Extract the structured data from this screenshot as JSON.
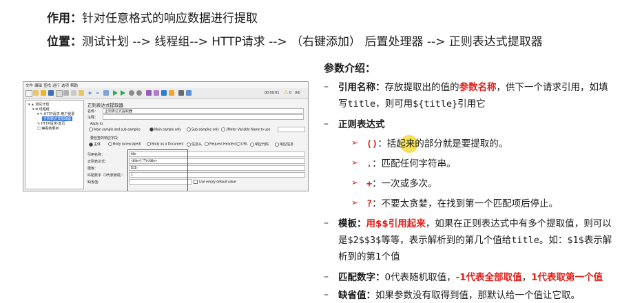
{
  "colors": {
    "accent_red": "#e0201a",
    "highlight": "#f5dd3c"
  },
  "top": {
    "role_label": "作用：",
    "role_text": "针对任意格式的响应数据进行提取",
    "pos_label": "位置：",
    "pos_text": "测试计划 --> 线程组--> HTTP请求 --> （右键添加） 后置处理器 --> 正则表达式提取器"
  },
  "jmeter": {
    "menu": [
      "文件",
      "编辑",
      "查找",
      "运行",
      "选项",
      "帮助"
    ],
    "timer": "00:00:01",
    "warn": "0",
    "threads": "0/0",
    "tree": [
      "测试计划",
      "线程组",
      "HTTP请求-用户登录",
      "正则表达式提取器",
      "HTTP请求-首页",
      "察看结果树"
    ],
    "panel_title": "正则表达式提取器",
    "name_label": "名称：",
    "name_value": "正则表达式提取器",
    "comment_label": "注释：",
    "apply_to": "Apply to:",
    "apply_opts": [
      "Main sample and sub-samples",
      "Main sample only",
      "Sub-samples only",
      "JMeter Variable Name to use"
    ],
    "check_field_label": "要检查的响应字段",
    "field_opts": [
      "主体",
      "Body (unescaped)",
      "Body as a Document",
      "信息头",
      "Request Headers",
      "URL",
      "响应代码",
      "响应信息"
    ],
    "ref_label": "引用名称：",
    "ref_value": "title",
    "regex_label": "正则表达式：",
    "regex_value": "<title>(.*?)</title>",
    "template_label": "模板：",
    "template_value": "$1$",
    "match_label": "匹配数字（0代表随机）：",
    "match_value": "1",
    "default_label": "缺省值：",
    "default_check": "Use empty default value"
  },
  "params": {
    "heading": "参数介绍：",
    "ref_name_label": "引用名称：",
    "ref_name_text1": "存放提取出的值的",
    "ref_name_red": "参数名称",
    "ref_name_text2": "，供下一个请求引用，如填",
    "ref_name_line2a": "写",
    "ref_name_code1": "title",
    "ref_name_line2b": "，则可用",
    "ref_name_code2": "${title}",
    "ref_name_line2c": "引用它",
    "regex_label": "正则表达式",
    "regex_items": [
      {
        "sym": "()",
        "sep": "：",
        "text": "括起来的部分就是要提取的。"
      },
      {
        "sym": ".",
        "sep": "：",
        "text": "匹配任何字符串。"
      },
      {
        "sym": "+",
        "sep": "：",
        "text": "一次或多次。"
      },
      {
        "sym": "?",
        "sep": "：",
        "text": "不要太贪婪，在找到第一个匹配项后停止。"
      }
    ],
    "template_label": "模板：",
    "template_red": "用$$引用起来",
    "template_text1": "，如果在正则表达式中有多个提取值，则可以",
    "template_line2a": "是",
    "template_code1": "$2$$3$",
    "template_line2b": "等等，表示解析到的第几个值给",
    "template_code2": "title",
    "template_line2c": "。如：",
    "template_code3": "$1$",
    "template_line2d": "表示解",
    "template_line3": "析到的第1个值",
    "match_label": "匹配数字：",
    "match_text1": "0代表随机取值，",
    "match_red1": "-1代表全部取值",
    "match_text2": "，",
    "match_red2": "1代表取第一个值",
    "default_label": "缺省值：",
    "default_text": "如果参数没有取得到值，那默认给一个值让它取。"
  }
}
